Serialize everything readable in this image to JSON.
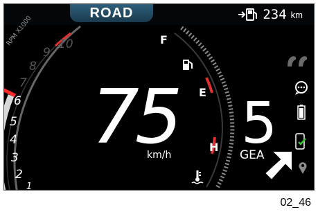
{
  "mode": {
    "label": "ROAD"
  },
  "range": {
    "value": "234",
    "unit": "km",
    "icon": "fuel-range-icon"
  },
  "tach": {
    "title": "RPM X1000",
    "ticks": [
      "10",
      "9",
      "8",
      "7",
      "6",
      "5",
      "4",
      "3",
      "2",
      "1"
    ],
    "redline_color": "#e03030",
    "needle_color": "#ff2a2a"
  },
  "speed": {
    "value": "75",
    "unit": "km/h"
  },
  "fuel": {
    "full_label": "F",
    "empty_label": "E",
    "icon": "fuel-pump-icon"
  },
  "temp": {
    "hot_label": "H",
    "icon": "coolant-temp-icon"
  },
  "gear": {
    "value": "5",
    "label": "GEA"
  },
  "status_icons": [
    "riding-mode-icon",
    "message-bubble-icon",
    "battery-icon",
    "phone-connected-icon",
    "location-pin-icon"
  ],
  "footer": {
    "code": "02_46"
  },
  "colors": {
    "accent": "#2f5f7a",
    "red": "#e03030",
    "green": "#3fbf3f",
    "gray": "#8a8a8a"
  }
}
